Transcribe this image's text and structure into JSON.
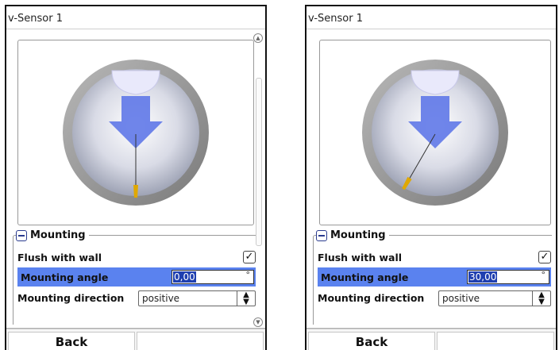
{
  "panels": [
    {
      "title": "v-Sensor 1",
      "mounting": {
        "group_label": "Mounting",
        "flush_label": "Flush with wall",
        "flush_checked": true,
        "angle_label": "Mounting angle",
        "angle_value": "0,00",
        "angle_unit": "°",
        "direction_label": "Mounting direction",
        "direction_value": "positive"
      },
      "back_label": "Back",
      "probe_angle_deg": 0
    },
    {
      "title": "v-Sensor 1",
      "mounting": {
        "group_label": "Mounting",
        "flush_label": "Flush with wall",
        "flush_checked": true,
        "angle_label": "Mounting angle",
        "angle_value": "30,00",
        "angle_unit": "°",
        "direction_label": "Mounting direction",
        "direction_value": "positive"
      },
      "back_label": "Back",
      "probe_angle_deg": 30
    }
  ],
  "colors": {
    "highlight_row": "#5a82ef",
    "selection": "#1f3fb0",
    "arrow": "#5f78e8",
    "probe": "#e0a800"
  },
  "icons": {
    "checkbox": "check-icon",
    "group_toggle": "collapse-minus-icon",
    "select_toggle": "updown-arrows-icon"
  }
}
